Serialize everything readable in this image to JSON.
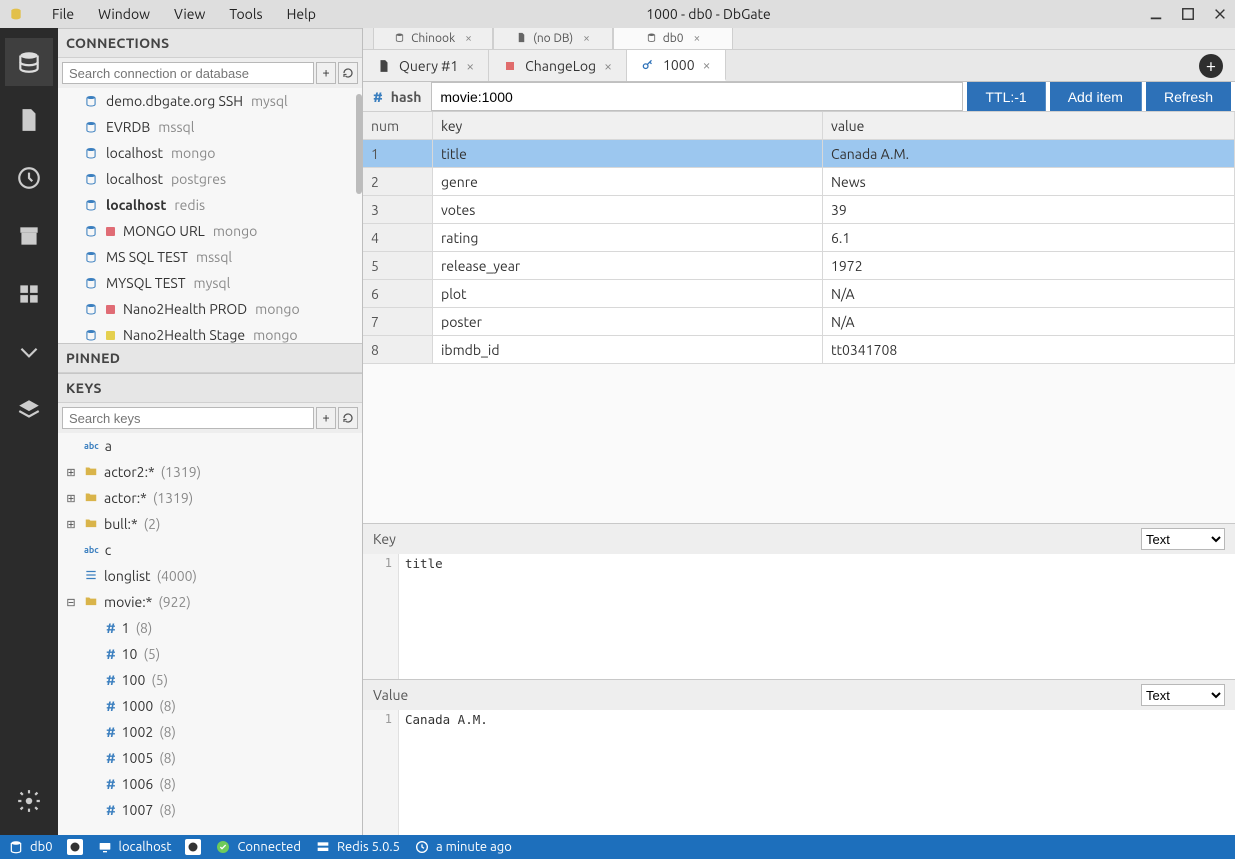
{
  "window": {
    "title": "1000 - db0 - DbGate",
    "menus": [
      "File",
      "Window",
      "View",
      "Tools",
      "Help"
    ]
  },
  "activitybar": {
    "items": [
      "database",
      "file",
      "history",
      "archive",
      "plugins",
      "chevron-down",
      "layers"
    ],
    "bottom": [
      "settings"
    ]
  },
  "connections": {
    "header": "CONNECTIONS",
    "search_placeholder": "Search connection or database",
    "items": [
      {
        "name": "demo.dbgate.org SSH",
        "engine": "mysql",
        "bold": false,
        "sq": "blue"
      },
      {
        "name": "EVRDB",
        "engine": "mssql",
        "bold": false,
        "sq": "blue"
      },
      {
        "name": "localhost",
        "engine": "mongo",
        "bold": false,
        "sq": "blue"
      },
      {
        "name": "localhost",
        "engine": "postgres",
        "bold": false,
        "sq": "blue"
      },
      {
        "name": "localhost",
        "engine": "redis",
        "bold": true,
        "sq": "blue"
      },
      {
        "name": "MONGO URL",
        "engine": "mongo",
        "bold": false,
        "sq": "red"
      },
      {
        "name": "MS SQL TEST",
        "engine": "mssql",
        "bold": false,
        "sq": "blue"
      },
      {
        "name": "MYSQL TEST",
        "engine": "mysql",
        "bold": false,
        "sq": "blue"
      },
      {
        "name": "Nano2Health PROD",
        "engine": "mongo",
        "bold": false,
        "sq": "red"
      },
      {
        "name": "Nano2Health Stage",
        "engine": "mongo",
        "bold": false,
        "sq": "yellow"
      }
    ]
  },
  "pinned": {
    "header": "PINNED"
  },
  "keys": {
    "header": "KEYS",
    "search_placeholder": "Search keys",
    "tree": [
      {
        "type": "leaf-abc",
        "label": "a",
        "depth": 1
      },
      {
        "type": "folder",
        "exp": "plus",
        "label": "actor2:*",
        "count": "(1319)",
        "depth": 0
      },
      {
        "type": "folder",
        "exp": "plus",
        "label": "actor:*",
        "count": "(1319)",
        "depth": 0
      },
      {
        "type": "folder",
        "exp": "plus",
        "label": "bull:*",
        "count": "(2)",
        "depth": 0
      },
      {
        "type": "leaf-abc",
        "label": "c",
        "depth": 1
      },
      {
        "type": "leaf-lines",
        "label": "longlist",
        "count": "(4000)",
        "depth": 1
      },
      {
        "type": "folder",
        "exp": "minus",
        "label": "movie:*",
        "count": "(922)",
        "depth": 0
      },
      {
        "type": "leaf-hash",
        "label": "1",
        "count": "(8)",
        "depth": 2
      },
      {
        "type": "leaf-hash",
        "label": "10",
        "count": "(5)",
        "depth": 2
      },
      {
        "type": "leaf-hash",
        "label": "100",
        "count": "(5)",
        "depth": 2
      },
      {
        "type": "leaf-hash",
        "label": "1000",
        "count": "(8)",
        "depth": 2
      },
      {
        "type": "leaf-hash",
        "label": "1002",
        "count": "(8)",
        "depth": 2
      },
      {
        "type": "leaf-hash",
        "label": "1005",
        "count": "(8)",
        "depth": 2
      },
      {
        "type": "leaf-hash",
        "label": "1006",
        "count": "(8)",
        "depth": 2
      },
      {
        "type": "leaf-hash",
        "label": "1007",
        "count": "(8)",
        "depth": 2
      }
    ]
  },
  "dbtabs": [
    {
      "label": "Chinook",
      "icon": "db",
      "active": false
    },
    {
      "label": "(no DB)",
      "icon": "file",
      "active": false
    },
    {
      "label": "db0",
      "icon": "db",
      "active": true
    }
  ],
  "filetabs": [
    {
      "label": "Query #1",
      "icon": "file",
      "color": "#444",
      "active": false
    },
    {
      "label": "ChangeLog",
      "icon": "square",
      "color": "#e06c6c",
      "active": false
    },
    {
      "label": "1000",
      "icon": "key",
      "color": "#2d71b8",
      "active": true
    }
  ],
  "hash": {
    "label": "hash",
    "key": "movie:1000",
    "buttons": {
      "ttl": "TTL:-1",
      "add": "Add item",
      "refresh": "Refresh"
    }
  },
  "grid": {
    "headers": {
      "num": "num",
      "key": "key",
      "value": "value"
    },
    "rows": [
      {
        "n": "1",
        "k": "title",
        "v": "Canada A.M.",
        "selected": true
      },
      {
        "n": "2",
        "k": "genre",
        "v": "News"
      },
      {
        "n": "3",
        "k": "votes",
        "v": "39"
      },
      {
        "n": "4",
        "k": "rating",
        "v": "6.1"
      },
      {
        "n": "5",
        "k": "release_year",
        "v": "1972"
      },
      {
        "n": "6",
        "k": "plot",
        "v": "N/A"
      },
      {
        "n": "7",
        "k": "poster",
        "v": "N/A"
      },
      {
        "n": "8",
        "k": "ibmdb_id",
        "v": "tt0341708"
      }
    ]
  },
  "editors": {
    "key_label": "Key",
    "value_label": "Value",
    "mode": "Text",
    "key_line": "1",
    "key_text": "title",
    "value_line": "1",
    "value_text": "Canada A.M."
  },
  "statusbar": {
    "db": "db0",
    "host": "localhost",
    "connected": "Connected",
    "engine": "Redis 5.0.5",
    "time": "a minute ago"
  }
}
